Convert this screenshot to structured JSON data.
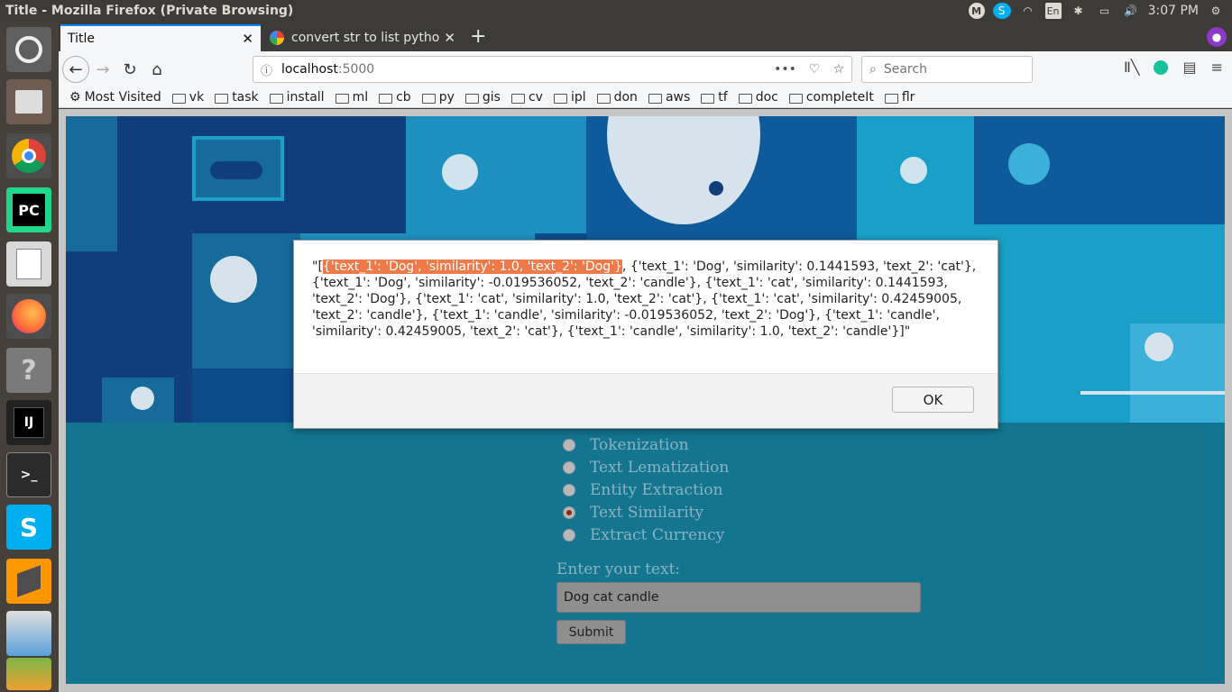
{
  "window": {
    "title": "Title - Mozilla Firefox (Private Browsing)"
  },
  "tray": {
    "time": "3:07 PM",
    "lang": "En",
    "mail_letter": "M",
    "skype_letter": "S"
  },
  "tabs": [
    {
      "label": "Title",
      "active": true
    },
    {
      "label": "convert str to list pytho",
      "active": false
    }
  ],
  "url": {
    "host": "localhost",
    "port": ":5000"
  },
  "search": {
    "placeholder": "Search"
  },
  "bookmarks": [
    "Most Visited",
    "vk",
    "task",
    "install",
    "ml",
    "cb",
    "py",
    "gis",
    "cv",
    "ipl",
    "don",
    "aws",
    "tf",
    "doc",
    "completeIt",
    "flr"
  ],
  "launcher": {
    "pycharm": "PC",
    "intellij": "IJ",
    "terminal": ">_",
    "skype": "S",
    "help": "?"
  },
  "form": {
    "options": [
      {
        "label": "Tokenization",
        "checked": false
      },
      {
        "label": "Text Lematization",
        "checked": false
      },
      {
        "label": "Entity Extraction",
        "checked": false
      },
      {
        "label": "Text Similarity",
        "checked": true
      },
      {
        "label": "Extract Currency",
        "checked": false
      }
    ],
    "input_label": "Enter your text:",
    "input_value": "Dog cat candle",
    "submit_label": "Submit"
  },
  "dialog": {
    "prefix": "\"[",
    "highlight": "{'text_1': 'Dog', 'similarity': 1.0, 'text_2': 'Dog'}",
    "rest": ", {'text_1': 'Dog', 'similarity': 0.1441593, 'text_2': 'cat'}, {'text_1': 'Dog', 'similarity': -0.019536052, 'text_2': 'candle'}, {'text_1': 'cat', 'similarity': 0.1441593, 'text_2': 'Dog'}, {'text_1': 'cat', 'similarity': 1.0, 'text_2': 'cat'}, {'text_1': 'cat', 'similarity': 0.42459005, 'text_2': 'candle'}, {'text_1': 'candle', 'similarity': -0.019536052, 'text_2': 'Dog'}, {'text_1': 'candle', 'similarity': 0.42459005, 'text_2': 'cat'}, {'text_1': 'candle', 'similarity': 1.0, 'text_2': 'candle'}]\"",
    "ok_label": "OK"
  }
}
